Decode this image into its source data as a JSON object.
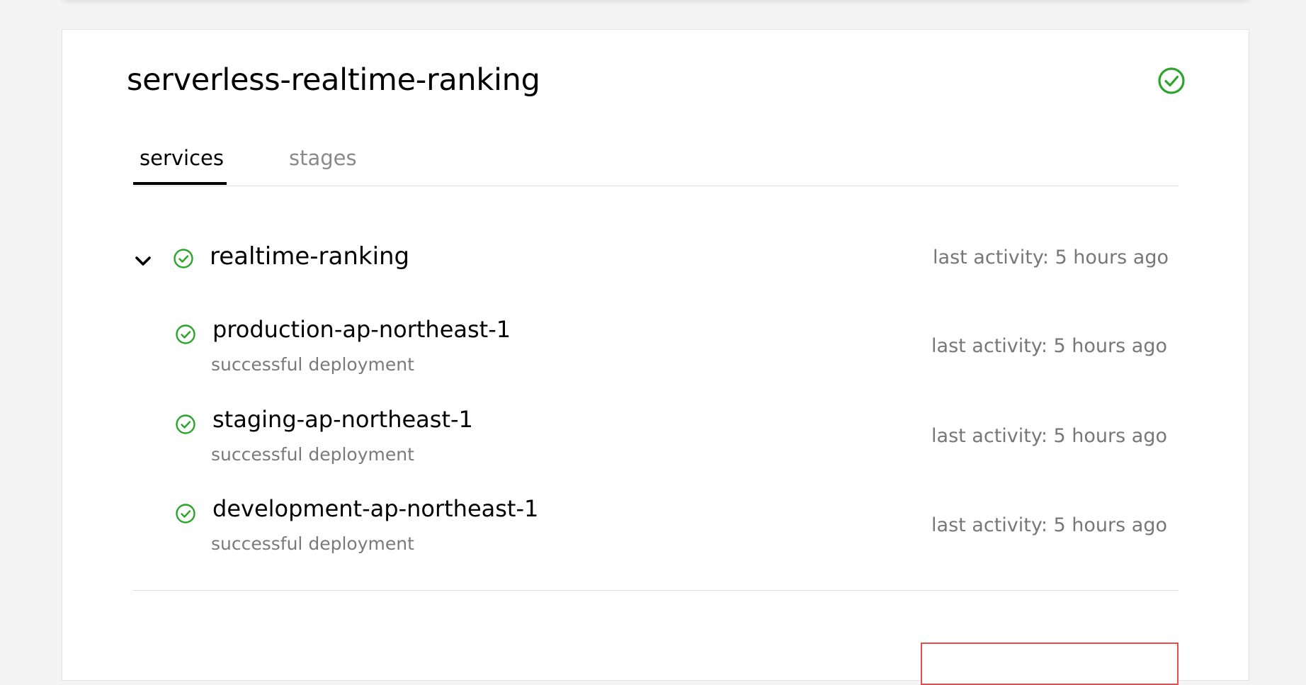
{
  "app": {
    "title": "serverless-realtime-ranking",
    "status_icon": "check-circle-icon",
    "status_color": "#2aa52a"
  },
  "tabs": [
    {
      "label": "services",
      "active": true
    },
    {
      "label": "stages",
      "active": false
    }
  ],
  "service": {
    "name": "realtime-ranking",
    "activity": "last activity: 5 hours ago",
    "expanded": true,
    "status_icon": "check-circle-icon",
    "stages": [
      {
        "name": "production-ap-northeast-1",
        "status": "successful deployment",
        "activity": "last activity: 5 hours ago",
        "status_icon": "check-circle-icon"
      },
      {
        "name": "staging-ap-northeast-1",
        "status": "successful deployment",
        "activity": "last activity: 5 hours ago",
        "status_icon": "check-circle-icon"
      },
      {
        "name": "development-ap-northeast-1",
        "status": "successful deployment",
        "activity": "last activity: 5 hours ago",
        "status_icon": "check-circle-icon"
      }
    ]
  },
  "colors": {
    "success": "#2aa52a",
    "danger": "#e84c4c",
    "muted_text": "#777777",
    "divider": "#dcdcdc"
  }
}
